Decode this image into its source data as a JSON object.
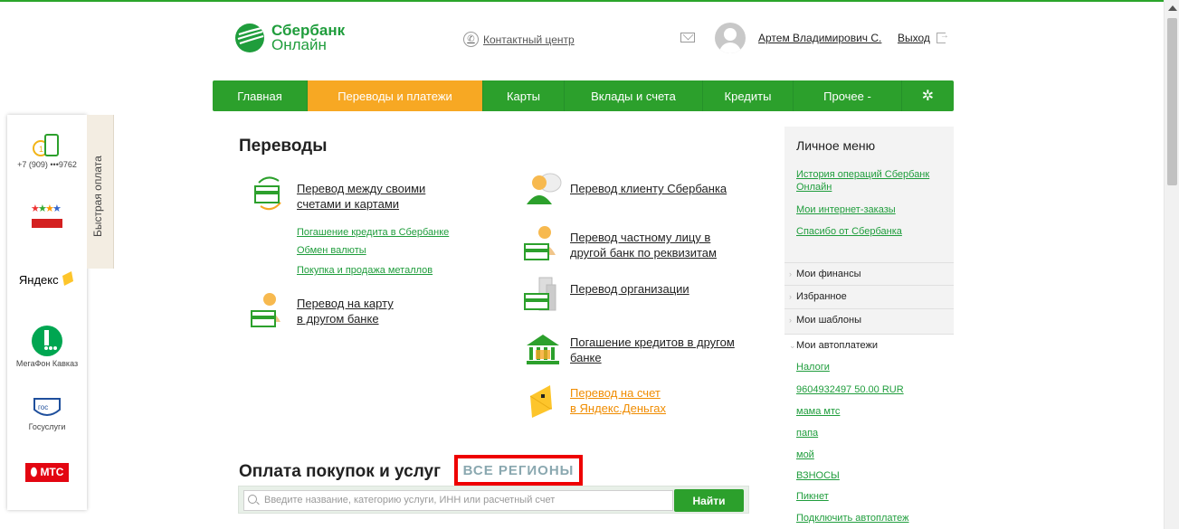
{
  "header": {
    "logo_line1": "Сбербанк",
    "logo_line2": "Онлайн",
    "contact_center": "Контактный центр",
    "username": "Артем Владимирович С.",
    "logout": "Выход"
  },
  "nav": {
    "items": [
      {
        "label": "Главная",
        "active": false
      },
      {
        "label": "Переводы и платежи",
        "active": true
      },
      {
        "label": "Карты",
        "active": false
      },
      {
        "label": "Вклады и счета",
        "active": false
      },
      {
        "label": "Кредиты",
        "active": false
      },
      {
        "label": "Прочее -",
        "active": false
      }
    ],
    "settings_icon": "gear-icon"
  },
  "quick_pay": {
    "tab_label": "Быстрая оплата",
    "phone": "+7 (909) •••9762",
    "megafon": "МегаФон Кавказ",
    "gosuslugi": "Госуслуги",
    "yandex": "Яндекс",
    "mts": "МТС"
  },
  "transfers": {
    "title": "Переводы",
    "own_accounts_1": "Перевод между своими",
    "own_accounts_2": "счетами и картами",
    "sub_credit": "Погашение кредита в Сбербанке",
    "sub_exchange": "Обмен валюты",
    "sub_metals": "Покупка и продажа металлов",
    "card_other_1": "Перевод на карту",
    "card_other_2": "в другом банке",
    "client_sber": "Перевод клиенту Сбербанка",
    "private_1": "Перевод частному лицу в",
    "private_2": "другой банк по реквизитам",
    "organization": "Перевод организации",
    "credit_other_1": "Погашение кредитов в другом",
    "credit_other_2": "банке",
    "yandex_1": "Перевод на счет",
    "yandex_2": "в Яндекс.Деньгах"
  },
  "payments": {
    "title": "Оплата покупок и услуг",
    "regions": "ВСЕ РЕГИОНЫ",
    "search_placeholder": "Введите название, категорию услуги, ИНН или расчетный счет",
    "find_button": "Найти"
  },
  "personal_menu": {
    "title": "Личное меню",
    "history_1": "История операций Сбербанк",
    "history_2": "Онлайн",
    "internet_orders": "Мои интернет-заказы",
    "spasibo": "Спасибо от Сбербанка",
    "sections": [
      "Мои финансы",
      "Избранное",
      "Мои шаблоны"
    ],
    "autopay_title": "Мои автоплатежи",
    "autopay_items": [
      "Налоги",
      "9604932497 50.00 RUR",
      "мама мтс",
      "папа",
      "мой",
      "ВЗНОСЫ",
      "Пикнет",
      "Подключить автоплатеж"
    ]
  },
  "colors": {
    "brand_green": "#2ca02c",
    "active_orange": "#f7a823",
    "link_green": "#1f9d3c",
    "highlight_red": "#ee0000"
  }
}
